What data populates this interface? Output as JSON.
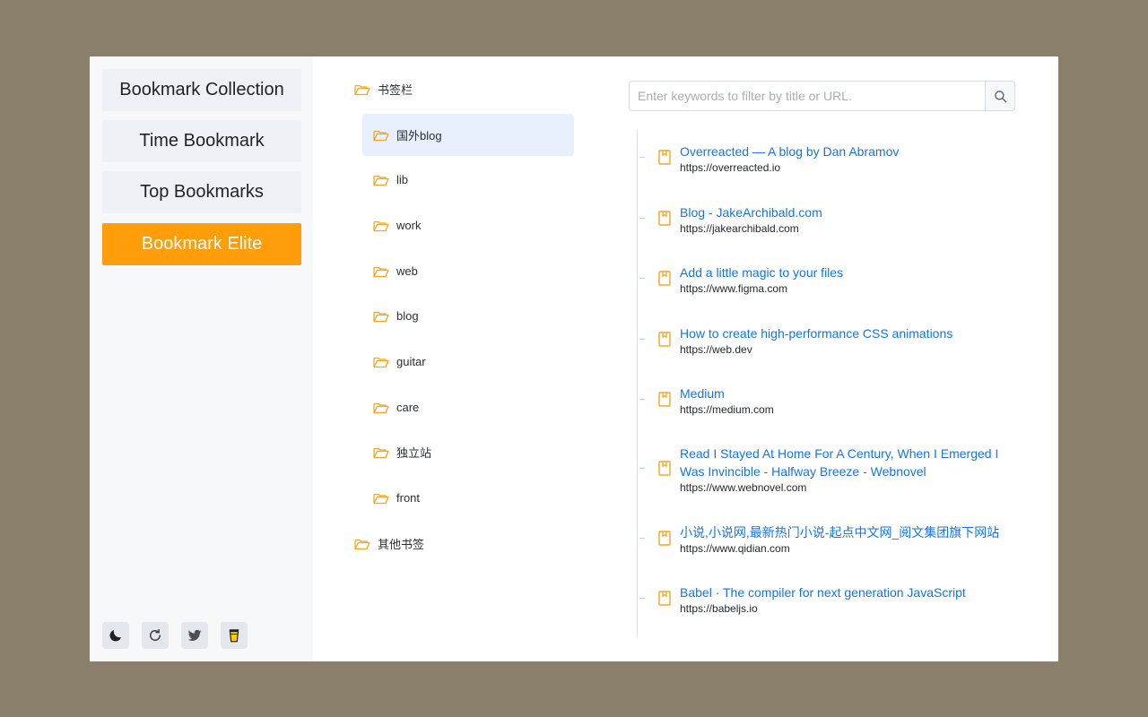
{
  "sidebar": {
    "items": [
      {
        "label": "Bookmark Collection",
        "active": false
      },
      {
        "label": "Time Bookmark",
        "active": false
      },
      {
        "label": "Top Bookmarks",
        "active": false
      },
      {
        "label": "Bookmark Elite",
        "active": true
      }
    ],
    "tools": [
      "moon-icon",
      "refresh-icon",
      "twitter-icon",
      "coffee-cup-icon"
    ]
  },
  "tree": {
    "root": "书签栏",
    "children": [
      "国外blog",
      "lib",
      "work",
      "web",
      "blog",
      "guitar",
      "care",
      "独立站",
      "front"
    ],
    "selected": "国外blog",
    "other": "其他书签"
  },
  "search": {
    "placeholder": "Enter keywords to filter by title or URL."
  },
  "bookmarks": [
    {
      "title": "Overreacted — A blog by Dan Abramov",
      "url": "https://overreacted.io"
    },
    {
      "title": "Blog - JakeArchibald.com",
      "url": "https://jakearchibald.com"
    },
    {
      "title": "Add a little magic to your files",
      "url": "https://www.figma.com"
    },
    {
      "title": "How to create high-performance CSS animations",
      "url": "https://web.dev"
    },
    {
      "title": "Medium",
      "url": "https://medium.com"
    },
    {
      "title": "Read I Stayed At Home For A Century, When I Emerged I Was Invincible - Halfway Breeze - Webnovel",
      "url": "https://www.webnovel.com"
    },
    {
      "title": "小说,小说网,最新热门小说-起点中文网_阅文集团旗下网站",
      "url": "https://www.qidian.com"
    },
    {
      "title": "Babel · The compiler for next generation JavaScript",
      "url": "https://babeljs.io"
    }
  ],
  "colors": {
    "accent": "#ff9d0a",
    "link": "#1574e6",
    "folder": "#f5a623",
    "background": "#8a806c"
  }
}
